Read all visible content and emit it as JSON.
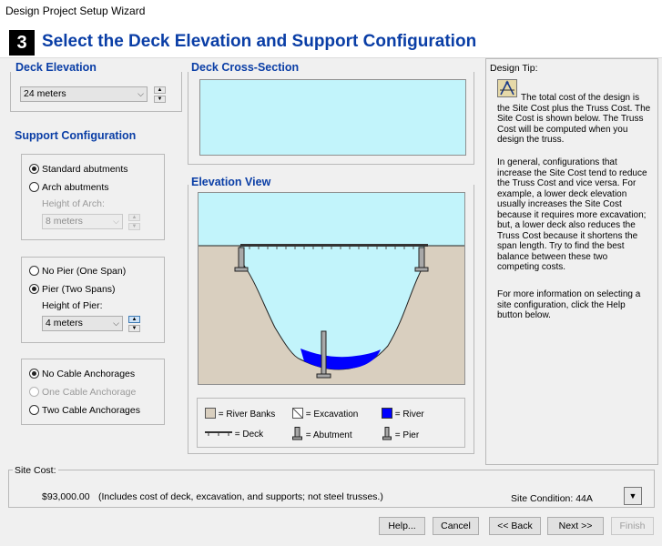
{
  "window": {
    "title": "Design Project Setup Wizard"
  },
  "header": {
    "step": "3",
    "title": "Select the Deck Elevation and Support Configuration"
  },
  "deck_elevation": {
    "title": "Deck Elevation",
    "value": "24 meters"
  },
  "support": {
    "title": "Support Configuration",
    "abutments": {
      "standard": "Standard abutments",
      "arch": "Arch abutments",
      "height_label": "Height of Arch:",
      "height_value": "8 meters",
      "selected": "standard"
    },
    "pier": {
      "no_pier": "No Pier (One Span)",
      "pier": "Pier (Two Spans)",
      "height_label": "Height of Pier:",
      "height_value": "4 meters",
      "selected": "pier"
    },
    "cable": {
      "none": "No Cable Anchorages",
      "one": "One Cable Anchorage",
      "two": "Two Cable Anchorages",
      "selected": "none"
    }
  },
  "cross_section": {
    "title": "Deck Cross-Section"
  },
  "elevation_view": {
    "title": "Elevation View"
  },
  "legend": {
    "river_banks": "= River Banks",
    "excavation": "= Excavation",
    "river": "= River",
    "deck": "= Deck",
    "abutment": "= Abutment",
    "pier": "= Pier"
  },
  "design_tip": {
    "title": "Design Tip:",
    "p1": "The total cost of the design is the Site Cost plus the Truss Cost. The Site Cost is shown below. The Truss Cost will be computed when you design the truss.",
    "p2": "In general, configurations that increase the Site Cost tend to reduce the Truss Cost and vice versa. For example, a lower deck elevation usually increases the Site Cost because it requires more excavation; but, a lower deck also reduces the Truss Cost because it shortens the span length. Try to find the best balance between these two competing costs.",
    "p3": "For more information on selecting a site configuration, click the Help button below."
  },
  "site_cost": {
    "label": "Site Cost:",
    "value": "$93,000.00",
    "note": "(Includes cost of deck, excavation, and supports; not steel trusses.)",
    "condition": "Site Condition: 44A"
  },
  "buttons": {
    "help": "Help...",
    "cancel": "Cancel",
    "back": "<< Back",
    "next": "Next >>",
    "finish": "Finish"
  },
  "colors": {
    "title_blue": "#0a3ea6",
    "sky": "#c2f4fb",
    "river": "#0000ff",
    "river_banks": "#d9cfbf",
    "concrete": "#a8a8a8"
  }
}
